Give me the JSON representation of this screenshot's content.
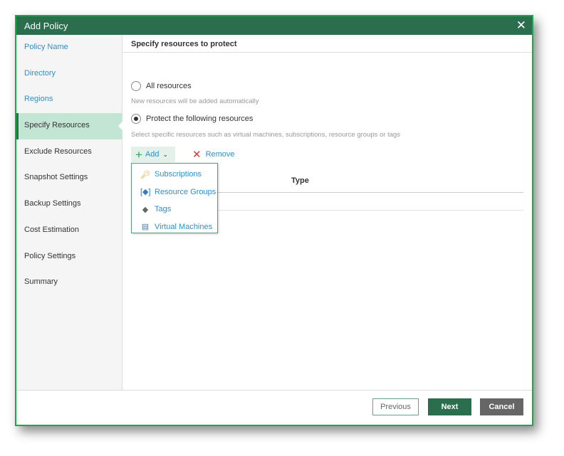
{
  "dialog": {
    "title": "Add Policy"
  },
  "sidebar": {
    "items": [
      {
        "label": "Policy Name",
        "state": "link"
      },
      {
        "label": "Directory",
        "state": "link"
      },
      {
        "label": "Regions",
        "state": "link"
      },
      {
        "label": "Specify Resources",
        "state": "active"
      },
      {
        "label": "Exclude Resources",
        "state": "plain"
      },
      {
        "label": "Snapshot Settings",
        "state": "plain"
      },
      {
        "label": "Backup Settings",
        "state": "plain"
      },
      {
        "label": "Cost Estimation",
        "state": "plain"
      },
      {
        "label": "Policy Settings",
        "state": "plain"
      },
      {
        "label": "Summary",
        "state": "plain"
      }
    ]
  },
  "main": {
    "heading": "Specify resources to protect",
    "option_all": {
      "label": "All resources",
      "hint": "New resources will be added automatically",
      "selected": false
    },
    "option_specific": {
      "label": "Protect the following resources",
      "hint": "Select specific resources such as virtual machines, subscriptions, resource groups or tags",
      "selected": true
    },
    "toolbar": {
      "add": "Add",
      "remove": "Remove"
    },
    "table": {
      "columns": [
        "Type"
      ]
    },
    "add_menu": [
      {
        "label": "Subscriptions",
        "icon": "key-icon"
      },
      {
        "label": "Resource Groups",
        "icon": "resource-group-icon"
      },
      {
        "label": "Tags",
        "icon": "tag-icon"
      },
      {
        "label": "Virtual Machines",
        "icon": "virtual-machine-icon"
      }
    ]
  },
  "footer": {
    "previous": "Previous",
    "next": "Next",
    "cancel": "Cancel"
  },
  "colors": {
    "header": "#2b6e4e",
    "border": "#1fa64a",
    "link": "#2d8fc7",
    "active": "#c3e6d4"
  }
}
